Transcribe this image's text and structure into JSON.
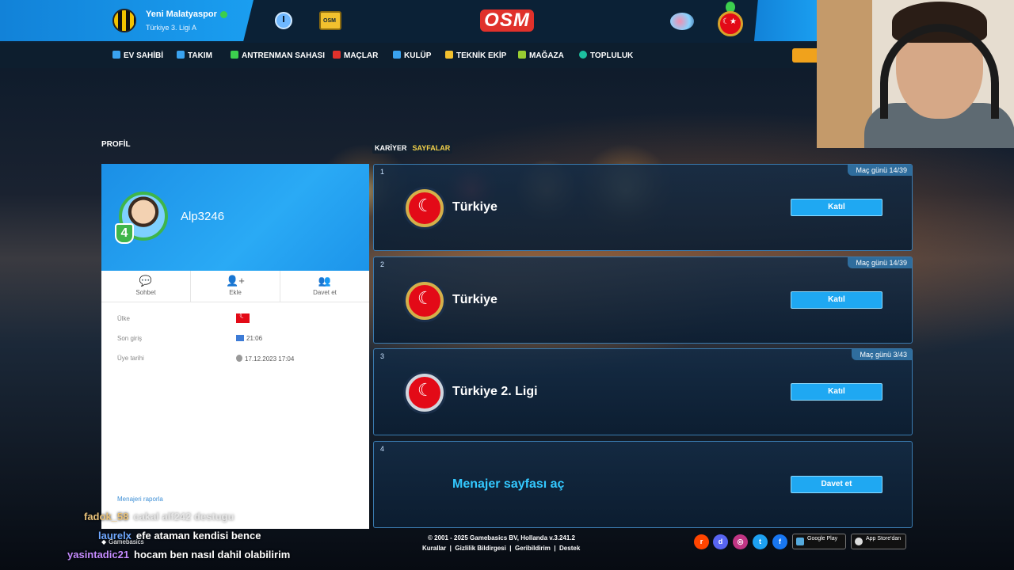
{
  "topbar": {
    "club_name": "Yeni Malatyaspor",
    "club_league": "Türkiye 3. Ligi A",
    "logo_text": "OSM",
    "shop_label": "OSM"
  },
  "nav": [
    {
      "label": "EV SAHİBİ",
      "icon": "home-icon",
      "color": "#3aa3f0"
    },
    {
      "label": "TAKIM",
      "icon": "shirt-icon",
      "color": "#3aa3f0"
    },
    {
      "label": "ANTRENMAN SAHASI",
      "icon": "training-icon",
      "color": "#3ccf4e"
    },
    {
      "label": "MAÇLAR",
      "icon": "calendar-icon",
      "color": "#e0312b"
    },
    {
      "label": "KULÜP",
      "icon": "club-icon",
      "color": "#3aa3f0"
    },
    {
      "label": "TEKNİK EKİP",
      "icon": "staff-icon",
      "color": "#f2c12e"
    },
    {
      "label": "MAĞAZA",
      "icon": "shop-icon",
      "color": "#9acd32"
    },
    {
      "label": "TOPLULUK",
      "icon": "community-icon",
      "color": "#1cc0a0"
    }
  ],
  "page": {
    "profile_title": "PROFİL",
    "tabs": [
      {
        "label": "KARİYER",
        "active": false
      },
      {
        "label": "SAYFALAR",
        "active": true
      }
    ]
  },
  "profile": {
    "username": "Alp3246",
    "level": "4",
    "actions": [
      {
        "label": "Sohbet",
        "icon": "chat-icon"
      },
      {
        "label": "Ekle",
        "icon": "add-user-icon"
      },
      {
        "label": "Davet et",
        "icon": "invite-icon"
      }
    ],
    "country_label": "Ülke",
    "last_login_label": "Son giriş",
    "last_login_value": "21:06",
    "member_since_label": "Üye tarihi",
    "member_since_value": "17.12.2023 17:04",
    "report_link": "Menajeri raporla"
  },
  "leagues": [
    {
      "number": "1",
      "day": "Maç günü 14/39",
      "name": "Türkiye",
      "button": "Katıl"
    },
    {
      "number": "2",
      "day": "Maç günü 14/39",
      "name": "Türkiye",
      "button": "Katıl"
    },
    {
      "number": "3",
      "day": "Maç günü 3/43",
      "name": "Türkiye 2. Ligi",
      "button": "Katıl"
    },
    {
      "number": "4",
      "day": "",
      "name": "Menajer sayfası aç",
      "button": "Davet et"
    }
  ],
  "footer": {
    "copyright": "© 2001 - 2025 Gamebasics BV, Hollanda v.3.241.2",
    "links": [
      "Kurallar",
      "Gizlilik Bildirgesi",
      "Geribildirim",
      "Destek"
    ],
    "google_play": "Google Play",
    "app_store": "App Store'dan"
  },
  "chat": [
    {
      "user": "fadok_58",
      "message": "cakal alf242 destugu"
    },
    {
      "user": "laurelx",
      "message": "efe ataman kendisi bence"
    },
    {
      "user": "yasintadic21",
      "message": "hocam ben nasıl dahil olabilirim"
    }
  ],
  "overlay": {
    "gamebasics": "Gamebasics"
  }
}
